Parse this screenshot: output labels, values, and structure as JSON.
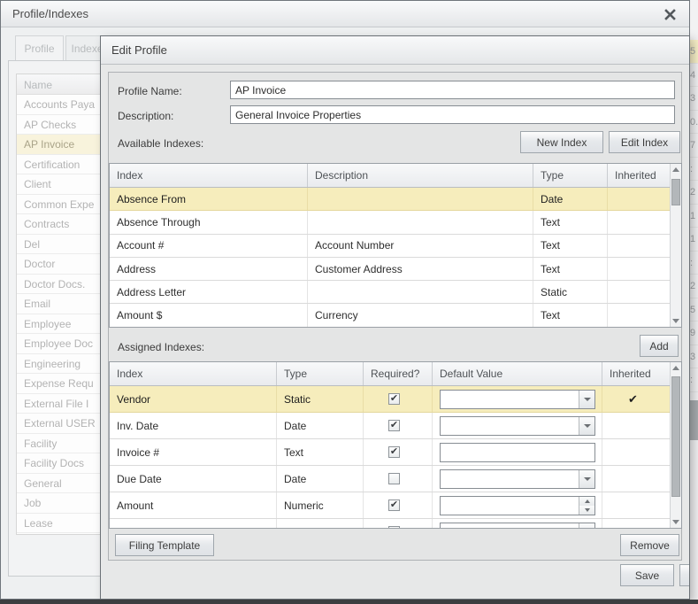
{
  "window": {
    "title": "Profile/Indexes"
  },
  "tabs": [
    {
      "label": "Profile",
      "active": true
    },
    {
      "label": "Indexes",
      "active": false
    }
  ],
  "profile_list": {
    "header": "Name",
    "selected": "AP Invoice",
    "items": [
      "Accounts Paya",
      "AP Checks",
      "AP Invoice",
      "Certification",
      "Client",
      "Common Expe",
      "Contracts",
      "Del",
      "Doctor",
      "Doctor Docs.",
      "Email",
      "Employee",
      "Employee Doc",
      "Engineering",
      "Expense Requ",
      "External File I",
      "External USER",
      "Facility",
      "Facility Docs",
      "General",
      "Job",
      "Lease"
    ]
  },
  "dialog": {
    "title": "Edit Profile",
    "fields": {
      "profile_name_label": "Profile Name:",
      "profile_name_value": "AP Invoice",
      "description_label": "Description:",
      "description_value": "General Invoice Properties"
    },
    "available": {
      "label": "Available Indexes:",
      "new_index_button": "New Index",
      "edit_index_button": "Edit Index",
      "columns": [
        "Index",
        "Description",
        "Type",
        "Inherited"
      ],
      "rows": [
        {
          "index": "Absence From",
          "description": "",
          "type": "Date",
          "inherited": "",
          "selected": true
        },
        {
          "index": "Absence Through",
          "description": "",
          "type": "Text",
          "inherited": ""
        },
        {
          "index": "Account #",
          "description": "Account Number",
          "type": "Text",
          "inherited": ""
        },
        {
          "index": "Address",
          "description": "Customer Address",
          "type": "Text",
          "inherited": ""
        },
        {
          "index": "Address Letter",
          "description": "",
          "type": "Static",
          "inherited": ""
        },
        {
          "index": "Amount $",
          "description": "Currency",
          "type": "Text",
          "inherited": ""
        }
      ]
    },
    "assigned": {
      "label": "Assigned Indexes:",
      "add_button": "Add",
      "columns": [
        "Index",
        "Type",
        "Required?",
        "Default Value",
        "Inherited"
      ],
      "rows": [
        {
          "index": "Vendor",
          "type": "Static",
          "required": true,
          "editor": "combo",
          "inherited": true,
          "selected": true
        },
        {
          "index": "Inv. Date",
          "type": "Date",
          "required": true,
          "editor": "combo",
          "inherited": false
        },
        {
          "index": "Invoice #",
          "type": "Text",
          "required": true,
          "editor": "text",
          "inherited": false
        },
        {
          "index": "Due Date",
          "type": "Date",
          "required": false,
          "editor": "combo",
          "inherited": false
        },
        {
          "index": "Amount",
          "type": "Numeric",
          "required": true,
          "editor": "spin",
          "inherited": false
        },
        {
          "index": "",
          "type": "",
          "required": false,
          "editor": "combo",
          "inherited": false,
          "partial": true
        }
      ]
    },
    "footer": {
      "filing_template_button": "Filing Template",
      "remove_button": "Remove",
      "save_button": "Save"
    }
  },
  "edge_fragments": [
    "5",
    "4",
    "3",
    "0.",
    "7",
    ":",
    "2",
    "1",
    "1",
    ":",
    "2",
    "5",
    "9",
    "3",
    ":"
  ],
  "colors": {
    "selection_yellow": "#f6edbc",
    "dimmed_selection_yellow": "#f8f3dc",
    "titlebar_top": "#f9fafb",
    "titlebar_bottom": "#e4e6e8",
    "grid_border": "#9aa0a6",
    "window_border": "#70767c",
    "bottom_edge": "#3c3e40"
  },
  "glyphs": {
    "check": "✔"
  }
}
